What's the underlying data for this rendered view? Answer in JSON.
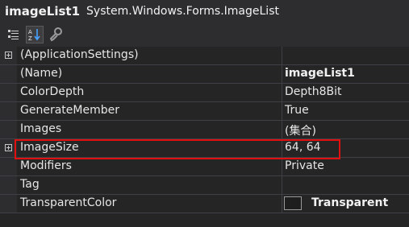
{
  "header": {
    "object_name": "imageList1",
    "object_type": "System.Windows.Forms.ImageList"
  },
  "toolbar": {
    "buttons": [
      {
        "icon": "categorized-icon",
        "active": false
      },
      {
        "icon": "alphabetical-icon",
        "active": true
      },
      {
        "icon": "property-pages-icon",
        "active": false
      }
    ]
  },
  "properties": [
    {
      "name": "(ApplicationSettings)",
      "value": "",
      "expandable": true
    },
    {
      "name": "(Name)",
      "value": "imageList1",
      "bold": true
    },
    {
      "name": "ColorDepth",
      "value": "Depth8Bit"
    },
    {
      "name": "GenerateMember",
      "value": "True"
    },
    {
      "name": "Images",
      "value": "(集合)"
    },
    {
      "name": "ImageSize",
      "value": "64, 64",
      "expandable": true,
      "highlighted": true
    },
    {
      "name": "Modifiers",
      "value": "Private"
    },
    {
      "name": "Tag",
      "value": ""
    },
    {
      "name": "TransparentColor",
      "value": "Transparent",
      "swatch_color": "#1e1e1e",
      "bold": true
    }
  ],
  "colors": {
    "highlight_border": "#e01010",
    "background": "#252526"
  }
}
